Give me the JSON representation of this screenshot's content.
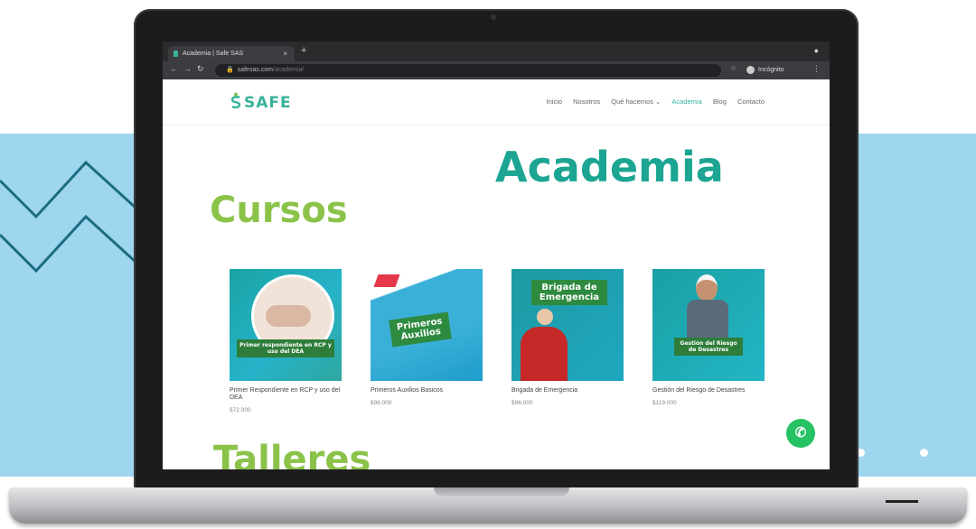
{
  "colors": {
    "accent_teal": "#1ba592",
    "accent_green": "#8bc34a",
    "background_blue": "#9ed6ef"
  },
  "browser": {
    "tab_title": "Academia | Safe SAS",
    "tab_close": "×",
    "new_tab": "+",
    "url_domain": "safesas.com",
    "url_path": "/academia/",
    "profile_label": "Incógnito"
  },
  "site": {
    "logo_text": "SAFE",
    "nav": [
      "Inicio",
      "Nosotros",
      "Qué hacemos ⌄",
      "Academia",
      "Blog",
      "Contacto"
    ],
    "active_nav": "Academia",
    "page_title": "Academia",
    "section_title": "Cursos",
    "next_section_title": "Talleres",
    "courses": [
      {
        "name": "Primer Respondiente en RCP y uso del DEA",
        "price": "$72.000",
        "thumb_text": "Primer respondiente en RCP y uso del DEA"
      },
      {
        "name": "Primeros Auxilios Basicos",
        "price": "$96.000",
        "thumb_text": "Primeros Auxilios"
      },
      {
        "name": "Brigada de Emergencia",
        "price": "$96.000",
        "thumb_text": "Brigada de Emergencia"
      },
      {
        "name": "Gestión del Riesgo de Desastres",
        "price": "$119.000",
        "thumb_text": "Gestión del Riesgo de Desastres"
      }
    ]
  },
  "icons": {
    "whatsapp": "whatsapp-icon"
  }
}
